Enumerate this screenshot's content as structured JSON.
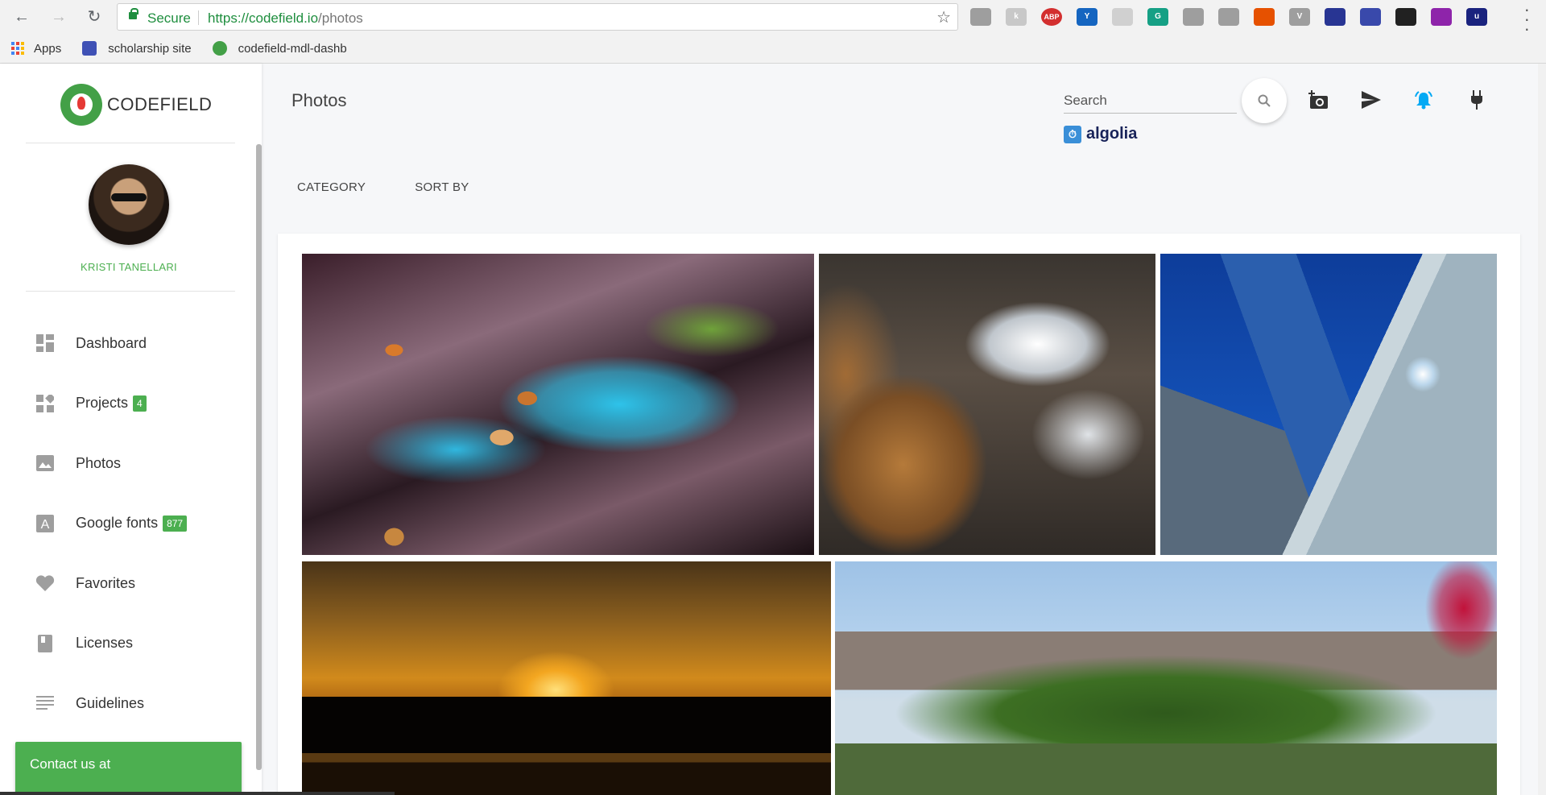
{
  "browser": {
    "secure_label": "Secure",
    "url_base": "https://codefield.io",
    "url_path": "/photos",
    "bookmarks": [
      {
        "label": "Apps"
      },
      {
        "label": "scholarship site"
      },
      {
        "label": "codefield-mdl-dashb"
      }
    ],
    "extensions": [
      {
        "name": "extension-1-icon",
        "text": "",
        "color": "#9e9e9e"
      },
      {
        "name": "extension-2-icon",
        "text": "k",
        "color": "#c8c8c8"
      },
      {
        "name": "adblock-icon",
        "text": "ABP",
        "color": "#d32f2f"
      },
      {
        "name": "extension-y-icon",
        "text": "Y",
        "color": "#1565c0"
      },
      {
        "name": "camera-ext-icon",
        "text": "",
        "color": "#d0d0d0"
      },
      {
        "name": "grammar-ext-icon",
        "text": "G",
        "color": "#16a085"
      },
      {
        "name": "grid-ext-icon",
        "text": "",
        "color": "#9e9e9e"
      },
      {
        "name": "screen-ext-icon",
        "text": "",
        "color": "#9e9e9e"
      },
      {
        "name": "office-ext-icon",
        "text": "",
        "color": "#e65100"
      },
      {
        "name": "v-ext-icon",
        "text": "V",
        "color": "#9e9e9e"
      },
      {
        "name": "photo-ext-icon",
        "text": "",
        "color": "#283593"
      },
      {
        "name": "book-ext-icon",
        "text": "",
        "color": "#3949ab"
      },
      {
        "name": "fire-ext-icon",
        "text": "",
        "color": "#212121"
      },
      {
        "name": "color-ext-icon",
        "text": "",
        "color": "#8e24aa"
      },
      {
        "name": "u-ext-icon",
        "text": "u",
        "color": "#1a237e"
      }
    ]
  },
  "sidebar": {
    "brand": "CODEFIELD",
    "user_name": "KRISTI TANELLARI",
    "items": [
      {
        "label": "Dashboard",
        "icon": "dashboard-icon",
        "badge": ""
      },
      {
        "label": "Projects",
        "icon": "projects-icon",
        "badge": "4"
      },
      {
        "label": "Photos",
        "icon": "photo-icon",
        "badge": ""
      },
      {
        "label": "Google fonts",
        "icon": "font-icon",
        "badge": "877"
      },
      {
        "label": "Favorites",
        "icon": "heart-icon",
        "badge": ""
      },
      {
        "label": "Licenses",
        "icon": "book-icon",
        "badge": ""
      },
      {
        "label": "Guidelines",
        "icon": "list-icon",
        "badge": ""
      }
    ],
    "contact_label": "Contact us at"
  },
  "main": {
    "title": "Photos",
    "search_placeholder": "Search",
    "algolia_label": "algolia",
    "filters": [
      "CATEGORY",
      "SORT BY"
    ],
    "actions": [
      "add-photo-icon",
      "send-icon",
      "notification-icon",
      "plugin-icon"
    ],
    "accent_color": "#4caf50",
    "photos": [
      {
        "name": "photo-mushroom-bark"
      },
      {
        "name": "photo-rocks-water"
      },
      {
        "name": "photo-skyscraper"
      },
      {
        "name": "photo-bridge-sunset"
      },
      {
        "name": "photo-central-park"
      }
    ]
  }
}
